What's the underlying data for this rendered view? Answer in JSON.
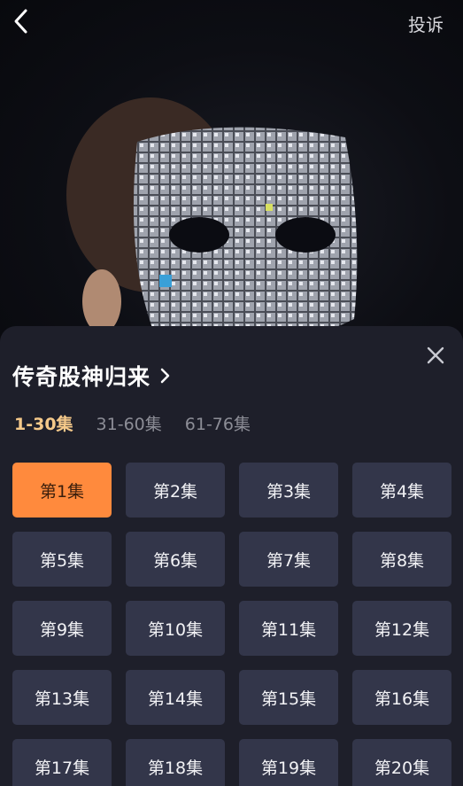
{
  "header": {
    "report_label": "投诉"
  },
  "sheet": {
    "title": "传奇股神归来",
    "ranges": [
      {
        "label": "1-30集",
        "active": true
      },
      {
        "label": "31-60集",
        "active": false
      },
      {
        "label": "61-76集",
        "active": false
      }
    ],
    "episodes": [
      {
        "label": "第1集",
        "active": true
      },
      {
        "label": "第2集"
      },
      {
        "label": "第3集"
      },
      {
        "label": "第4集"
      },
      {
        "label": "第5集"
      },
      {
        "label": "第6集"
      },
      {
        "label": "第7集"
      },
      {
        "label": "第8集"
      },
      {
        "label": "第9集"
      },
      {
        "label": "第10集"
      },
      {
        "label": "第11集"
      },
      {
        "label": "第12集"
      },
      {
        "label": "第13集"
      },
      {
        "label": "第14集"
      },
      {
        "label": "第15集"
      },
      {
        "label": "第16集"
      },
      {
        "label": "第17集"
      },
      {
        "label": "第18集"
      },
      {
        "label": "第19集"
      },
      {
        "label": "第20集"
      }
    ]
  },
  "colors": {
    "sheet_bg": "#1e1f2a",
    "tile_bg": "#33364a",
    "active_tile": "#ff8a3d",
    "active_range": "#f5c98a"
  },
  "icons": [
    "back-arrow-icon",
    "close-icon",
    "chevron-right-icon"
  ]
}
